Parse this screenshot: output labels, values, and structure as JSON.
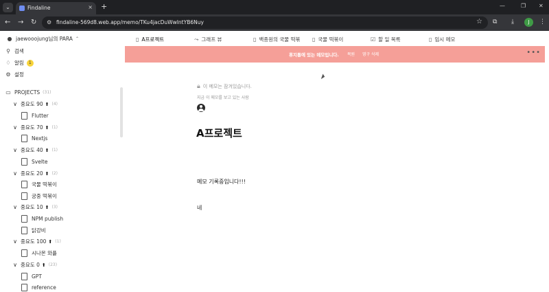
{
  "browser": {
    "tab_title": "Findaline",
    "tab_close": "×",
    "new_tab": "+",
    "menu_glyph": "⌄",
    "back": "←",
    "forward": "→",
    "reload": "↻",
    "url": "findaline-569d8.web.app/memo/TKu4jacDuWwIntYB6Nuy",
    "star": "☆",
    "profile_initial": "J",
    "win_min": "—",
    "win_max": "❐",
    "win_close": "✕"
  },
  "sidebar": {
    "user": "jaewooojung님의 PARA",
    "user_caret": "⌃",
    "search": "검색",
    "notifications": "알림",
    "notification_count": "1",
    "settings": "설정",
    "projects_label": "PROJECTS",
    "projects_count": "(31)",
    "groups": [
      {
        "label": "중요도 90",
        "count": "(4)",
        "items": [
          "Flutter"
        ]
      },
      {
        "label": "중요도 70",
        "count": "(1)",
        "items": [
          "Nextjs"
        ]
      },
      {
        "label": "중요도 40",
        "count": "(1)",
        "items": [
          "Svelte"
        ]
      },
      {
        "label": "중요도 20",
        "count": "(2)",
        "items": [
          "국물 떡볶이",
          "궁중 떡볶이"
        ]
      },
      {
        "label": "중요도 10",
        "count": "(3)",
        "items": [
          "NPM publish",
          "닭강비"
        ]
      },
      {
        "label": "중요도 100",
        "count": "(1)",
        "items": [
          "시나몬 와플"
        ]
      },
      {
        "label": "중요도 0",
        "count": "(23)",
        "items": [
          "GPT",
          "reference"
        ]
      }
    ]
  },
  "memo_tabs": [
    {
      "label": "A프로젝트",
      "icon": "document-icon",
      "active": true
    },
    {
      "label": "그래프 뷰",
      "icon": "graph-icon",
      "active": false
    },
    {
      "label": "백종원의 국물 떡볶",
      "icon": "document-icon",
      "active": false
    },
    {
      "label": "국물 떡볶이",
      "icon": "document-icon",
      "active": false
    },
    {
      "label": "할 일 목록",
      "icon": "checkbox-icon",
      "active": false
    },
    {
      "label": "임시 메모",
      "icon": "document-icon",
      "active": false
    }
  ],
  "banner": {
    "message": "휴지통에 있는 메모입니다.",
    "restore": "복원",
    "delete_forever": "영구 삭제",
    "more": "•••"
  },
  "memo": {
    "lock_text": "이 메모는 잠겨있습니다.",
    "lock_sub": "지금 이 메모를 보고 있는 사람",
    "title": "A프로젝트",
    "lines": [
      "메모 기록중입니다!!!",
      "네"
    ]
  }
}
